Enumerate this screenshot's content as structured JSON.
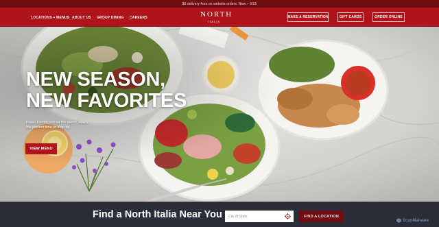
{
  "promo": {
    "text": "$0 delivery fees on website orders. Now – 9/15"
  },
  "nav": {
    "links": [
      "LOCATIONS + MENUS",
      "ABOUT US",
      "GROUP DINING",
      "CAREERS"
    ],
    "logo": {
      "main": "NORTH",
      "sub": "ITALIA"
    },
    "buttons": [
      "MAKE A RESERVATION",
      "GIFT CARDS",
      "ORDER ONLINE"
    ]
  },
  "hero": {
    "headline_line1": "NEW SEASON,",
    "headline_line2": "NEW FAVORITES",
    "copy": "Fresh flavors just hit the menu, now's the perfect time to stop by.",
    "cta": "VIEW MENU"
  },
  "locator": {
    "title": "Find a North Italia Near You",
    "input_placeholder": "City or State",
    "button": "FIND A LOCATION"
  },
  "watermark": {
    "text": "ScanMalware"
  },
  "colors": {
    "brand_red": "#b0141b",
    "dark_red": "#6e0d12",
    "locator_bg": "#2b2e39"
  },
  "icons": {
    "locate": "crosshair-icon",
    "watermark": "scanmalware-logo-icon"
  }
}
